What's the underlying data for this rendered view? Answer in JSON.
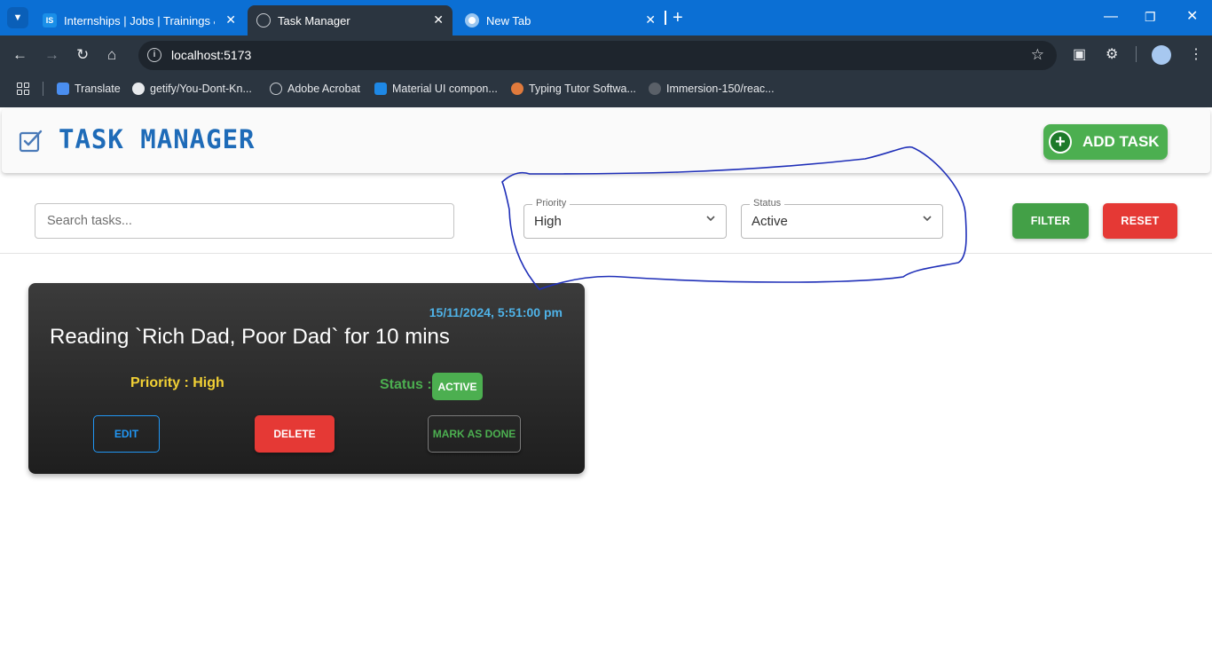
{
  "browser": {
    "tabs": [
      {
        "title": "Internships | Jobs | Trainings & C",
        "favicon": "IS"
      },
      {
        "title": "Task Manager",
        "favicon": "globe-icon"
      },
      {
        "title": "New Tab",
        "favicon": "chrome-icon"
      }
    ],
    "url": "localhost:5173",
    "bookmarks": [
      "Translate",
      "getify/You-Dont-Kn...",
      "Adobe Acrobat",
      "Material UI compon...",
      "Typing Tutor Softwa...",
      "Immersion-150/reac..."
    ]
  },
  "app": {
    "title": "TASK MANAGER",
    "add_task_label": "ADD TASK"
  },
  "filters": {
    "search_placeholder": "Search tasks...",
    "priority_label": "Priority",
    "priority_value": "High",
    "status_label": "Status",
    "status_value": "Active",
    "filter_label": "FILTER",
    "reset_label": "RESET"
  },
  "tasks": [
    {
      "date": "15/11/2024, 5:51:00 pm",
      "title": "Reading `Rich Dad, Poor Dad` for 10 mins",
      "priority_text": "Priority : High",
      "status_label": "Status :",
      "status_badge": "ACTIVE",
      "edit_label": "EDIT",
      "delete_label": "DELETE",
      "done_label": "MARK AS DONE"
    }
  ],
  "colors": {
    "tab_strip": "#0b6fd4",
    "toolbar": "#2b3540",
    "title_blue": "#1e6bb8",
    "green": "#4caf50",
    "red": "#e53935",
    "date_blue": "#4fb3e8",
    "priority_yellow": "#f2d135",
    "annotation_ink": "#1f2fb8"
  }
}
